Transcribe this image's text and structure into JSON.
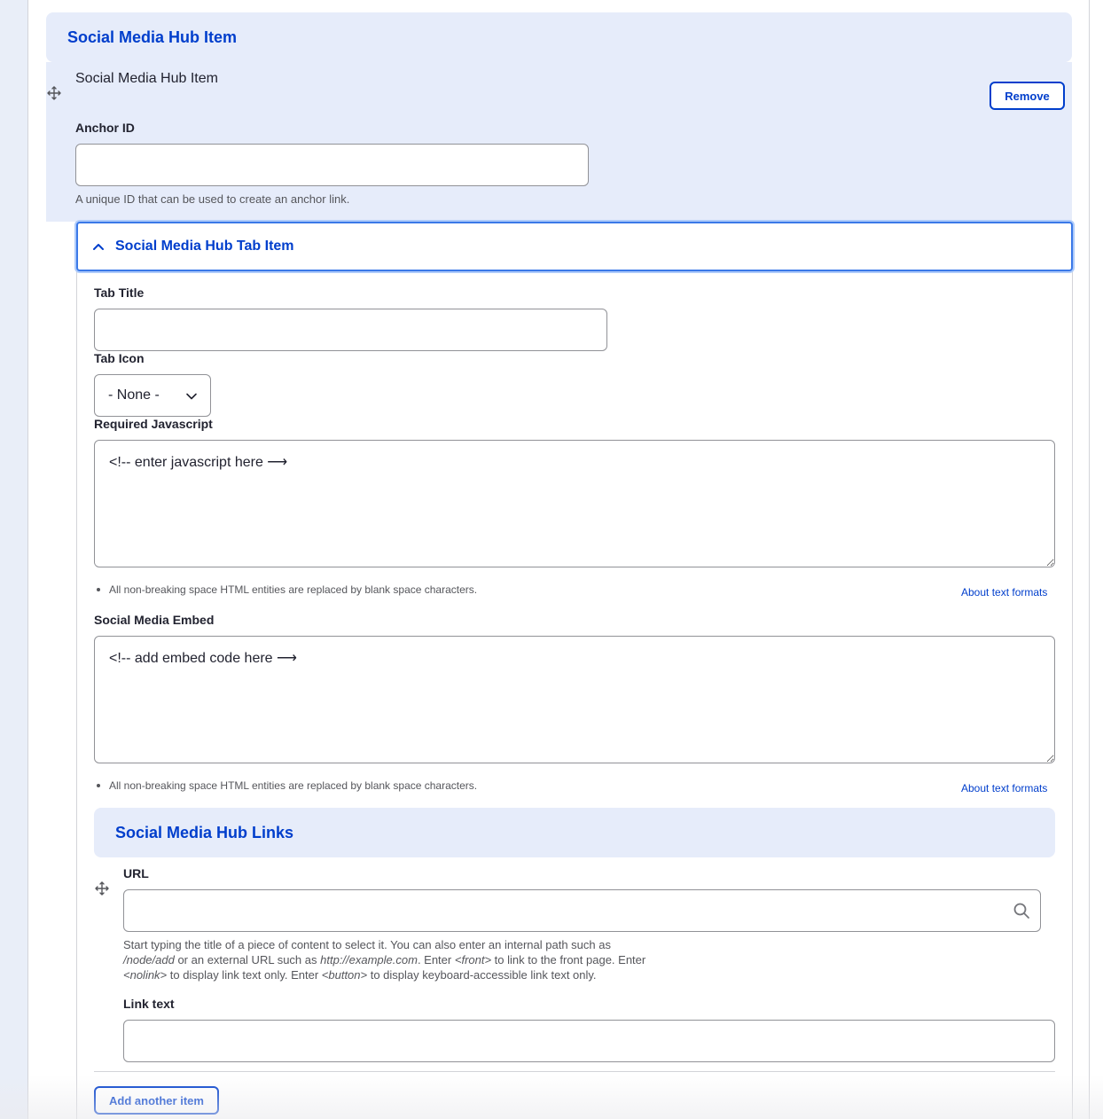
{
  "hub": {
    "section_title": "Social Media Hub Item",
    "item_title": "Social Media Hub Item",
    "remove_label": "Remove",
    "drag_icon": "move-icon"
  },
  "anchor": {
    "label": "Anchor ID",
    "value": "",
    "description": "A unique ID that can be used to create an anchor link."
  },
  "tab_item": {
    "title": "Social Media Hub Tab Item",
    "expanded": true,
    "tab_title": {
      "label": "Tab Title",
      "value": ""
    },
    "tab_icon": {
      "label": "Tab Icon",
      "selected": "- None -"
    },
    "required_js": {
      "label": "Required Javascript",
      "value": "<!-- enter javascript here ⟶",
      "note": "All non-breaking space HTML entities are replaced by blank space characters.",
      "link": "About text formats"
    },
    "embed": {
      "label": "Social Media Embed",
      "value": "<!-- add embed code here ⟶",
      "note": "All non-breaking space HTML entities are replaced by blank space characters.",
      "link": "About text formats"
    }
  },
  "links": {
    "section_title": "Social Media Hub Links",
    "url": {
      "label": "URL",
      "value": "",
      "help_1": "Start typing the title of a piece of content to select it. You can also enter an internal path such as",
      "help_path": "/node/add",
      "help_2": " or an external URL such as ",
      "help_example": "http://example.com",
      "help_3": ". Enter ",
      "help_front": "<front>",
      "help_4": " to link to the front page. Enter",
      "help_nolink": "<nolink>",
      "help_5": " to display link text only. Enter ",
      "help_button": "<button>",
      "help_6": " to display keyboard-accessible link text only."
    },
    "link_text": {
      "label": "Link text",
      "value": ""
    },
    "add_label": "Add another item"
  },
  "colors": {
    "accent": "#003ecc",
    "header_bg": "#e6ecfa",
    "focus_border": "#3b79e8"
  }
}
